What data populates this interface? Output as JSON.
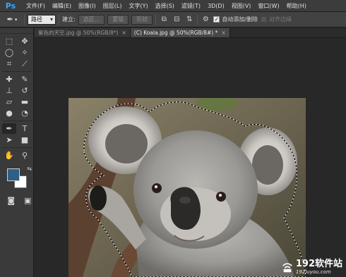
{
  "app": {
    "logo_text": "Ps"
  },
  "menu": [
    "文件(F)",
    "编辑(E)",
    "图像(I)",
    "图层(L)",
    "文字(Y)",
    "选择(S)",
    "滤镜(T)",
    "3D(D)",
    "视图(V)",
    "窗口(W)",
    "帮助(H)"
  ],
  "options": {
    "tool_icon": "pen-icon",
    "mode_value": "路径",
    "make_label": "建立:",
    "selection_btn": "选区...",
    "mask_btn": "蒙版",
    "shape_btn": "形状",
    "auto_add_delete_label": "自动添加/删除",
    "auto_add_delete_checked": true,
    "align_edges_label": "对齐边缘",
    "align_edges_checked": false
  },
  "tabs": [
    {
      "label": "紫色的天空.jpg @ 50%(RGB/8*)",
      "close": "×",
      "active": false
    },
    {
      "label": "(C) Koala.jpg @ 50%(RGB/8#) *",
      "close": "×",
      "active": true
    }
  ],
  "colors": {
    "foreground": "#2e5f86",
    "background": "#ffffff",
    "ps_blue": "#31a8ff"
  },
  "watermark": {
    "big": "192软件站",
    "small": "192luyou.com"
  }
}
